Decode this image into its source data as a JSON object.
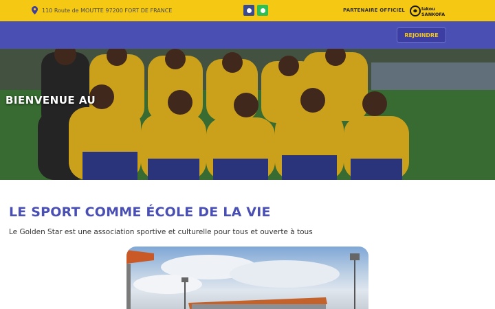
{
  "topbar": {
    "address": "110 Route de MOUTTE 97200 FORT DE FRANCE",
    "address_icon": "map-pin-icon",
    "socials": [
      {
        "name": "facebook-icon"
      },
      {
        "name": "whatsapp-icon"
      }
    ],
    "partner_label": "PARTENAIRE OFFICIEL",
    "partner_logo_text": "Lakou SANKOFA"
  },
  "nav": {
    "join_label": "REJOINDRE"
  },
  "hero": {
    "title": "BIENVENUE AU"
  },
  "main": {
    "heading": "LE SPORT COMME ÉCOLE DE LA VIE",
    "tagline": "Le Golden Star est une association sportive et culturelle pour tous et ouverte à tous"
  },
  "colors": {
    "topbar": "#f5c814",
    "nav": "#4a4fb3",
    "heading": "#4a4fb3",
    "button_text": "#f5c814"
  }
}
